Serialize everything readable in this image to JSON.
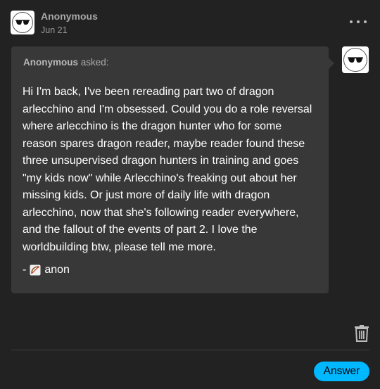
{
  "post": {
    "author": "Anonymous",
    "date": "Jun 21",
    "more_icon": "ellipsis-icon"
  },
  "ask": {
    "asker_name": "Anonymous",
    "asked_label": " asked:",
    "question_lines": [
      "Hi I'm back, I've been rereading part two of dragon",
      "arlecchino and I'm obsessed. Could you do a role reversal",
      "where arlecchino is the dragon hunter who for some",
      "reason spares dragon reader, maybe reader found these",
      "three unsupervised dragon hunters in training and goes",
      "\"my kids now\" while Arlecchino's freaking out about her",
      "missing kids. Or just more of daily life with dragon",
      "arlecchino, now that she's following reader everywhere,",
      "and the fallout of the events of part 2. I love the",
      "worldbuilding btw, please tell me more."
    ],
    "signoff_prefix": "-",
    "signoff_icon": "bow-and-arrow-emoji",
    "signoff_text": "anon"
  },
  "actions": {
    "delete_icon": "trash-icon",
    "answer_label": "Answer"
  },
  "colors": {
    "background": "#222222",
    "ask_box": "#383838",
    "accent": "#00b8ff"
  }
}
